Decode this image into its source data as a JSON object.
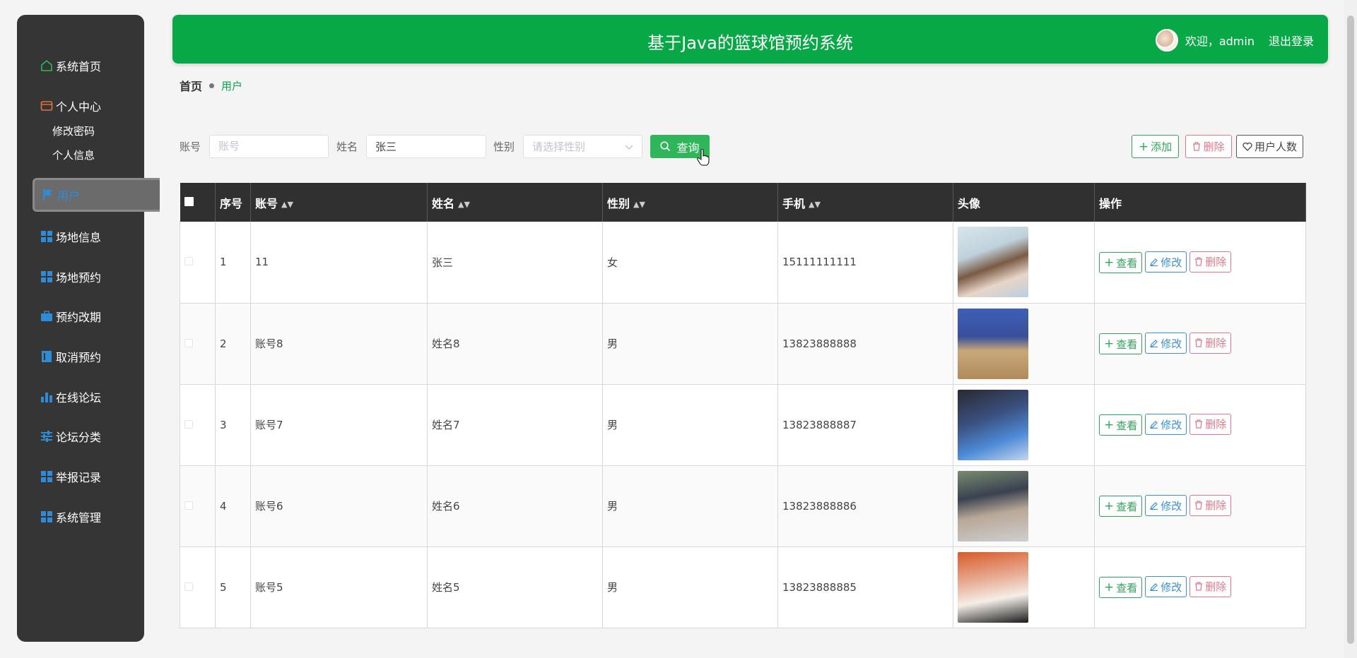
{
  "sidebar": {
    "items": [
      {
        "label": "系统首页",
        "icon": "home-icon"
      },
      {
        "label": "个人中心",
        "icon": "wallet-icon"
      },
      {
        "label": "用户",
        "icon": "flag-icon"
      },
      {
        "label": "场地信息",
        "icon": "grid-icon"
      },
      {
        "label": "场地预约",
        "icon": "grid-icon"
      },
      {
        "label": "预约改期",
        "icon": "briefcase-icon"
      },
      {
        "label": "取消预约",
        "icon": "book-icon"
      },
      {
        "label": "在线论坛",
        "icon": "bar-chart-icon"
      },
      {
        "label": "论坛分类",
        "icon": "sliders-icon"
      },
      {
        "label": "举报记录",
        "icon": "grid-icon"
      },
      {
        "label": "系统管理",
        "icon": "grid-icon"
      }
    ],
    "submenu": [
      "修改密码",
      "个人信息"
    ]
  },
  "header": {
    "title": "基于Java的篮球馆预约系统",
    "welcome": "欢迎，admin",
    "logout": "退出登录"
  },
  "breadcrumb": {
    "home": "首页",
    "current": "用户"
  },
  "search": {
    "account_label": "账号",
    "account_placeholder": "账号",
    "account_value": "",
    "name_label": "姓名",
    "name_value": "张三",
    "gender_label": "性别",
    "gender_placeholder": "请选择性别",
    "search_button": "查询"
  },
  "tools": {
    "add": "添加",
    "delete": "删除",
    "count": "用户人数"
  },
  "table": {
    "headers": [
      "序号",
      "账号",
      "姓名",
      "性别",
      "手机",
      "头像",
      "操作"
    ],
    "rows": [
      {
        "no": "1",
        "account": "11",
        "name": "张三",
        "gender": "女",
        "phone": "15111111111"
      },
      {
        "no": "2",
        "account": "账号8",
        "name": "姓名8",
        "gender": "男",
        "phone": "13823888888"
      },
      {
        "no": "3",
        "account": "账号7",
        "name": "姓名7",
        "gender": "男",
        "phone": "13823888887"
      },
      {
        "no": "4",
        "account": "账号6",
        "name": "姓名6",
        "gender": "男",
        "phone": "13823888886"
      },
      {
        "no": "5",
        "account": "账号5",
        "name": "姓名5",
        "gender": "男",
        "phone": "13823888885"
      }
    ],
    "ops": {
      "view": "查看",
      "edit": "修改",
      "delete": "删除"
    }
  },
  "colors": {
    "primary": "#09a847",
    "sidebar": "#353535",
    "accent_blue": "#2f8bd6",
    "danger": "#e0788a"
  }
}
